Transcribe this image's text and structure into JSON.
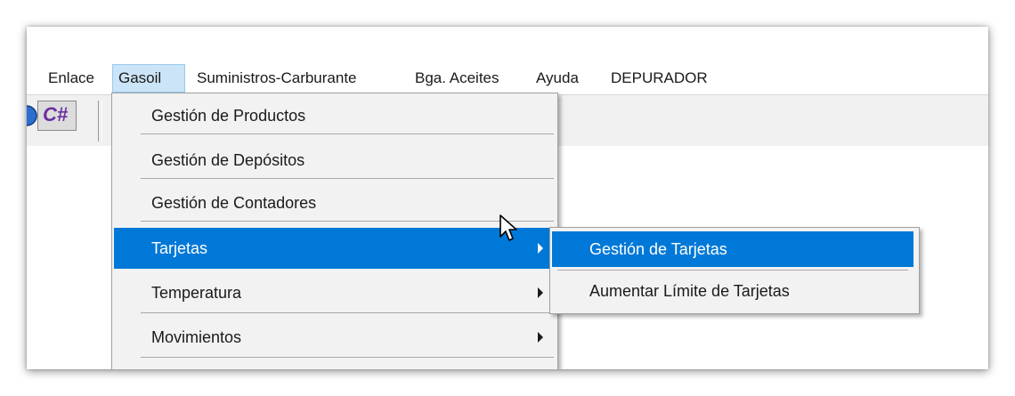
{
  "menubar": {
    "items": [
      {
        "label": "Enlace"
      },
      {
        "label": "Gasoil"
      },
      {
        "label": "Suministros-Carburante"
      },
      {
        "label": "Bga. Aceites"
      },
      {
        "label": "Ayuda"
      },
      {
        "label": "DEPURADOR"
      }
    ]
  },
  "toolbar": {
    "icons": [
      "globe-icon",
      "csharp-icon"
    ],
    "csharp_label": "C#"
  },
  "gasoil_menu": {
    "items": [
      {
        "label": "Gestión de Productos"
      },
      {
        "label": "Gestión de Depósitos"
      },
      {
        "label": "Gestión de Contadores"
      },
      {
        "label": "Tarjetas"
      },
      {
        "label": "Temperatura"
      },
      {
        "label": "Movimientos"
      }
    ]
  },
  "tarjetas_submenu": {
    "items": [
      {
        "label": "Gestión de Tarjetas"
      },
      {
        "label": "Aumentar Límite de Tarjetas"
      }
    ]
  },
  "colors": {
    "highlight": "#0078d7",
    "menubar_active": "#cce4f7",
    "menu_background": "#f2f2f2"
  }
}
